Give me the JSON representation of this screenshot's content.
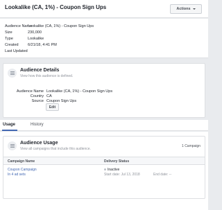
{
  "header": {
    "title": "Lookalike (CA, 1%) - Coupon Sign Ups",
    "actions_label": "Actions"
  },
  "summary": {
    "rows": [
      {
        "key": "Audience Name",
        "value": "Lookalike (CA, 1%) - Coupon Sign Ups"
      },
      {
        "key": "Size",
        "value": "230,000"
      },
      {
        "key": "Type",
        "value": "Lookalike"
      },
      {
        "key": "Created",
        "value": "6/21/18, 4:41 PM"
      },
      {
        "key": "Last Updated",
        "value": ""
      }
    ]
  },
  "details": {
    "title": "Audience Details",
    "subtitle": "View how this audience is defined.",
    "rows": [
      {
        "key": "Audience Name",
        "value": "Lookalike (CA, 1%) - Coupon Sign Ups"
      },
      {
        "key": "Country",
        "value": "CA"
      },
      {
        "key": "Source",
        "value": "Coupon Sign Ups"
      }
    ],
    "edit_label": "Edit"
  },
  "tabs": [
    {
      "label": "Usage",
      "active": true
    },
    {
      "label": "History",
      "active": false
    }
  ],
  "usage": {
    "title": "Audience Usage",
    "subtitle": "View all campaigns that include this audience.",
    "campaign_count": "1 Campaign",
    "columns": [
      "Campaign Name",
      "Delivery Status"
    ],
    "rows": [
      {
        "campaign": "Coupon Campaign",
        "ad_sets": "In 4 ad sets",
        "status": "Inactive",
        "start": "Start date: Jul 13, 2018",
        "end": "End date: --"
      }
    ]
  },
  "colors": {
    "accent": "#4267b2",
    "background": "#e9ebee"
  },
  "icons": [
    "caret-down-icon",
    "details-icon",
    "usage-icon",
    "status-dot-icon"
  ]
}
